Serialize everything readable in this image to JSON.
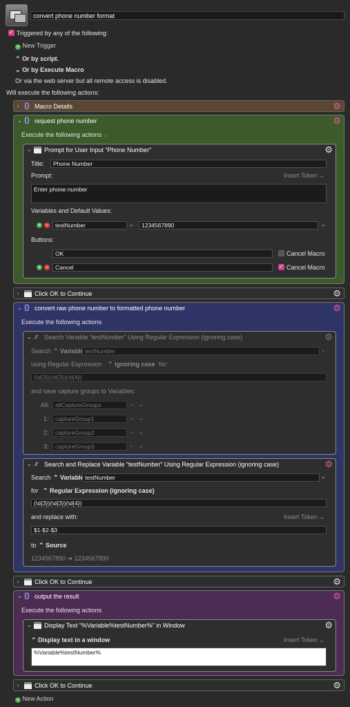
{
  "macro": {
    "title": "convert phone number format"
  },
  "triggers": {
    "checkbox_label": "Triggered by any of the following:",
    "new_trigger": "New Trigger",
    "by_script": "Or by script.",
    "by_execute": "Or by Execute Macro",
    "web_server": "Or via the web server but all remote access is disabled.",
    "will_execute": "Will execute the following actions:"
  },
  "macro_details": {
    "label": "Macro Details"
  },
  "group1": {
    "label": "request phone number",
    "execute": "Execute the following actions",
    "prompt": {
      "label": "Prompt for User Input “Phone Number”",
      "title_label": "Title:",
      "title_value": "Phone Number",
      "prompt_label": "Prompt:",
      "insert_token": "Insert Token",
      "prompt_value": "Enter phone number",
      "vars_label": "Variables and Default Values:",
      "var_name": "testNumber",
      "var_default": "1234567890",
      "buttons_label": "Buttons:",
      "btn1": "OK",
      "btn2": "Cancel",
      "cancel_macro": "Cancel Macro"
    }
  },
  "click_ok_1": "Click OK to Continue",
  "group2": {
    "label": "convert raw phone number to formatted phone number",
    "execute": "Execute the following actions",
    "search": {
      "label": "Search Variable “testNumber” Using Regular Expression (ignoring case)",
      "search_label": "Search",
      "variable": "Variable",
      "var_value": "testNumber",
      "using": "using Regular Expression",
      "ignoring": "ignoring case",
      "for": "for:",
      "regex": "(\\d{3})(\\d{3})(\\d{4})",
      "save_groups": "and save capture groups to Variables:",
      "all_label": "All:",
      "all_value": "allCaptureGroups",
      "g1_label": "1:",
      "g1": "captureGroup1",
      "g2_label": "2:",
      "g2": "captureGroup2",
      "g3_label": "3:",
      "g3": "captureGroup3"
    },
    "replace": {
      "label": "Search and Replace Variable “testNumber” Using Regular Expression (ignoring case)",
      "search_label": "Search",
      "variable": "Variable",
      "var_value": "testNumber",
      "for_label": "for",
      "regex_mode": "Regular Expression (ignoring case)",
      "regex": "(\\d{3})(\\d{3})(\\d{4})",
      "replace_label": "and replace with:",
      "insert_token": "Insert Token",
      "replacement": "$1-$2-$3",
      "to_label": "to",
      "source": "Source",
      "preview": "1234567890 ➔ 1234567890"
    }
  },
  "click_ok_2": "Click OK to Continue",
  "group3": {
    "label": "output the result",
    "execute": "Execute the following actions",
    "display": {
      "label": "Display Text “%Variable%testNumber%” in Window",
      "mode": "Display text in a window",
      "insert_token": "Insert Token",
      "text": "%Variable%testNumber%"
    }
  },
  "click_ok_3": "Click OK to Continue",
  "new_action": "New Action",
  "colors": {
    "details": "#5b4634",
    "green": "#3d5a2a",
    "blue": "#2f3466",
    "purple": "#4d2c54",
    "accent": "#d63f8c"
  }
}
